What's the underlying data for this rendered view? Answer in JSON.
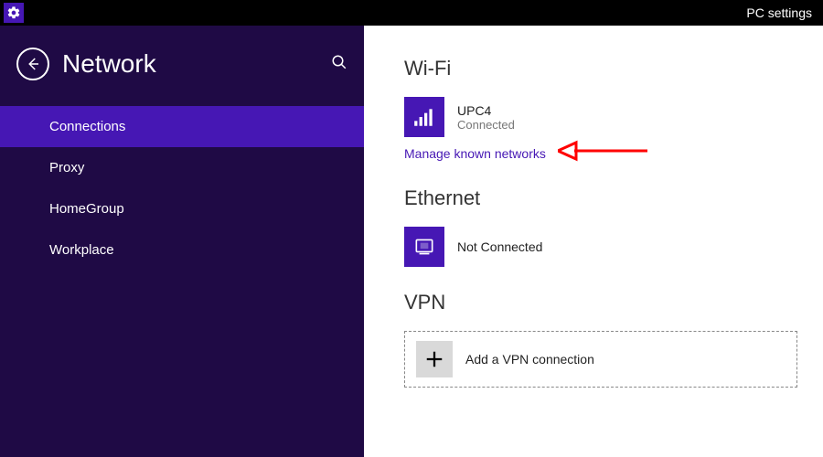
{
  "titlebar": {
    "app_title": "PC settings"
  },
  "sidebar": {
    "title": "Network",
    "items": [
      {
        "label": "Connections",
        "selected": true
      },
      {
        "label": "Proxy",
        "selected": false
      },
      {
        "label": "HomeGroup",
        "selected": false
      },
      {
        "label": "Workplace",
        "selected": false
      }
    ]
  },
  "content": {
    "wifi": {
      "heading": "Wi-Fi",
      "network_name": "UPC4",
      "status": "Connected",
      "manage_link": "Manage known networks"
    },
    "ethernet": {
      "heading": "Ethernet",
      "status": "Not Connected"
    },
    "vpn": {
      "heading": "VPN",
      "add_label": "Add a VPN connection"
    }
  },
  "colors": {
    "accent": "#4617b4",
    "sidebar_bg": "#1f0a45",
    "annotation": "#ff0000"
  }
}
